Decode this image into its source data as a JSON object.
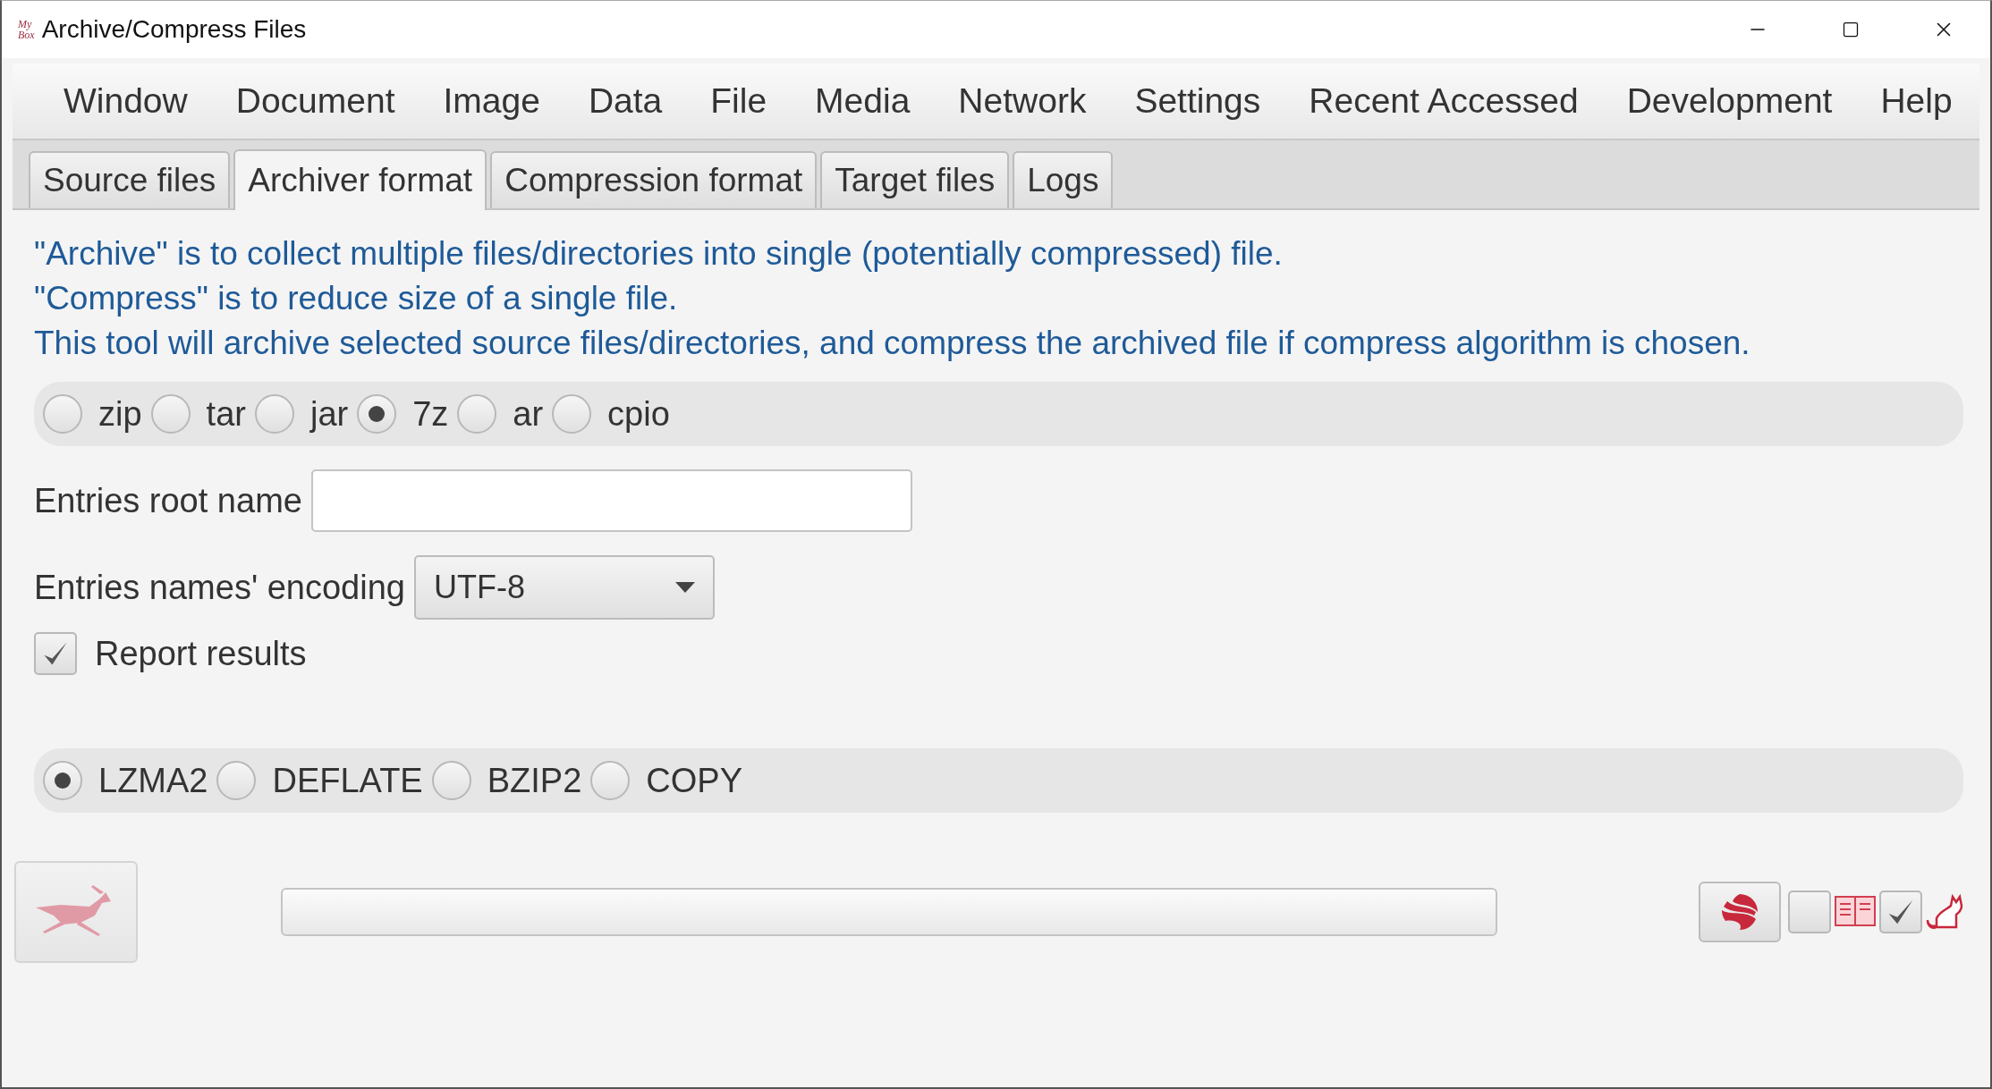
{
  "window": {
    "logo": [
      "My",
      "Box"
    ],
    "title": "Archive/Compress Files"
  },
  "menu": [
    "Window",
    "Document",
    "Image",
    "Data",
    "File",
    "Media",
    "Network",
    "Settings",
    "Recent Accessed",
    "Development",
    "Help"
  ],
  "tabs": [
    {
      "label": "Source files",
      "selected": false
    },
    {
      "label": "Archiver format",
      "selected": true
    },
    {
      "label": "Compression format",
      "selected": false
    },
    {
      "label": "Target files",
      "selected": false
    },
    {
      "label": "Logs",
      "selected": false
    }
  ],
  "info": [
    "\"Archive\" is to collect multiple files/directories into single (potentially compressed) file.",
    "\"Compress\" is to reduce size of a single file.",
    "This tool will archive selected source files/directories, and compress the archived file if compress algorithm is chosen."
  ],
  "archivers": [
    {
      "label": "zip",
      "selected": false
    },
    {
      "label": "tar",
      "selected": false
    },
    {
      "label": "jar",
      "selected": false
    },
    {
      "label": "7z",
      "selected": true
    },
    {
      "label": "ar",
      "selected": false
    },
    {
      "label": "cpio",
      "selected": false
    }
  ],
  "root_name": {
    "label": "Entries root name"
  },
  "encoding": {
    "label": "Entries names' encoding",
    "value": "UTF-8"
  },
  "report": {
    "label": "Report results",
    "checked": true
  },
  "compressors": [
    {
      "label": "LZMA2",
      "selected": true
    },
    {
      "label": "DEFLATE",
      "selected": false
    },
    {
      "label": "BZIP2",
      "selected": false
    },
    {
      "label": "COPY",
      "selected": false
    }
  ],
  "progress": {
    "level": 0
  },
  "toggles": [
    {
      "checked": false
    },
    {
      "checked": true
    }
  ]
}
